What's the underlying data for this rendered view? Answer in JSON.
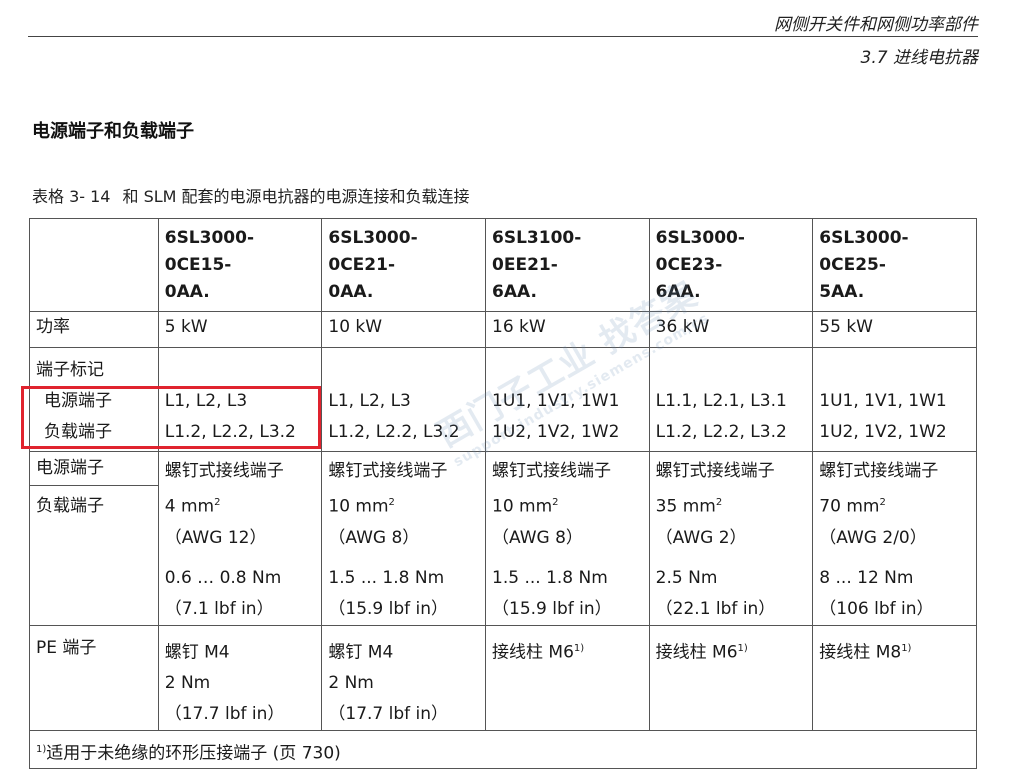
{
  "header": {
    "line1": "网侧开关件和网侧功率部件",
    "line2": "3.7 进线电抗器"
  },
  "section_title": "电源端子和负载端子",
  "caption": {
    "number": "表格 3- 14",
    "text": "和 SLM 配套的电源电抗器的电源连接和负载连接"
  },
  "table": {
    "models": [
      [
        "6SL3000-",
        "0CE15-",
        "0AA."
      ],
      [
        "6SL3000-",
        "0CE21-",
        "0AA."
      ],
      [
        "6SL3100-",
        "0EE21-",
        "6AA."
      ],
      [
        "6SL3000-",
        "0CE23-",
        "6AA."
      ],
      [
        "6SL3000-",
        "0CE25-",
        "5AA."
      ]
    ],
    "power_label": "功率",
    "power": [
      "5 kW",
      "10 kW",
      "16 kW",
      "36 kW",
      "55 kW"
    ],
    "terminal_mark_label": "端子标记",
    "supply_label": "电源端子",
    "load_label": "负载端子",
    "supply_marks": [
      "L1, L2, L3",
      "L1, L2, L3",
      "1U1, 1V1, 1W1",
      "L1.1, L2.1, L3.1",
      "1U1, 1V1, 1W1"
    ],
    "load_marks": [
      "L1.2, L2.2, L3.2",
      "L1.2, L2.2, L3.2",
      "1U2, 1V2, 1W2",
      "L1.2, L2.2, L3.2",
      "1U2, 1V2, 1W2"
    ],
    "conn_supply_label": "电源端子",
    "conn_load_label": "负载端子",
    "conn_type": [
      "螺钉式接线端子",
      "螺钉式接线端子",
      "螺钉式接线端子",
      "螺钉式接线端子",
      "螺钉式接线端子"
    ],
    "cross_section": [
      "4 mm",
      "10 mm",
      "10 mm",
      "35 mm",
      "70 mm"
    ],
    "cross_section_sup": "2",
    "awg": [
      "（AWG 12）",
      "（AWG 8）",
      "（AWG 8）",
      "（AWG 2）",
      "（AWG 2/0）"
    ],
    "torque_nm": [
      "0.6 … 0.8 Nm",
      "1.5 ... 1.8 Nm",
      "1.5 ... 1.8 Nm",
      "2.5 Nm",
      "8 ... 12 Nm"
    ],
    "torque_lbf": [
      "（7.1 lbf in）",
      "（15.9 lbf in）",
      "（15.9 lbf in）",
      "（22.1 lbf in）",
      "（106 lbf in）"
    ],
    "pe_label": "PE 端子",
    "pe_type": [
      "螺钉 M4",
      "螺钉 M4",
      "接线柱 M6",
      "接线柱 M6",
      "接线柱 M8"
    ],
    "pe_type_sup": [
      "",
      "",
      "1)",
      "1)",
      "1)"
    ],
    "pe_torque": [
      "2 Nm",
      "2 Nm",
      "",
      "",
      ""
    ],
    "pe_lbf": [
      "（17.7 lbf in）",
      "（17.7 lbf in）",
      "",
      "",
      ""
    ],
    "footnote_mark": "1)",
    "footnote_text": "适用于未绝缘的环形压接端子 (页 730)"
  },
  "watermark": {
    "text": "西门子工业 找答案",
    "url": "support.industry.siemens.com/cs"
  },
  "colors": {
    "highlight": "#e0232e",
    "border": "#555555"
  }
}
